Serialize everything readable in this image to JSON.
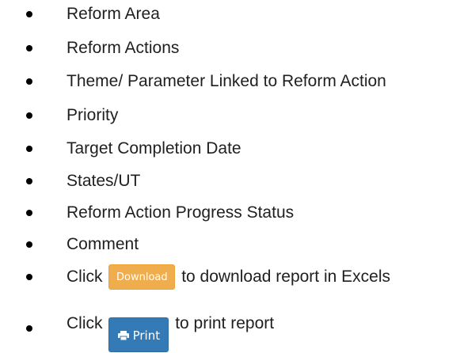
{
  "items": [
    "Reform Area",
    "Reform Actions",
    "Theme/ Parameter Linked to Reform Action",
    "Priority",
    "Target Completion Date",
    "States/UT",
    "Reform Action Progress Status",
    "Comment"
  ],
  "download_line": {
    "prefix": "Click",
    "button_label": "Download",
    "suffix": "to download report in Excels",
    "button_color": "#f0ad4e"
  },
  "print_line": {
    "prefix": "Click",
    "button_label": "Print",
    "suffix": "to print report",
    "button_icon": "print-icon",
    "button_color": "#337ab7"
  }
}
